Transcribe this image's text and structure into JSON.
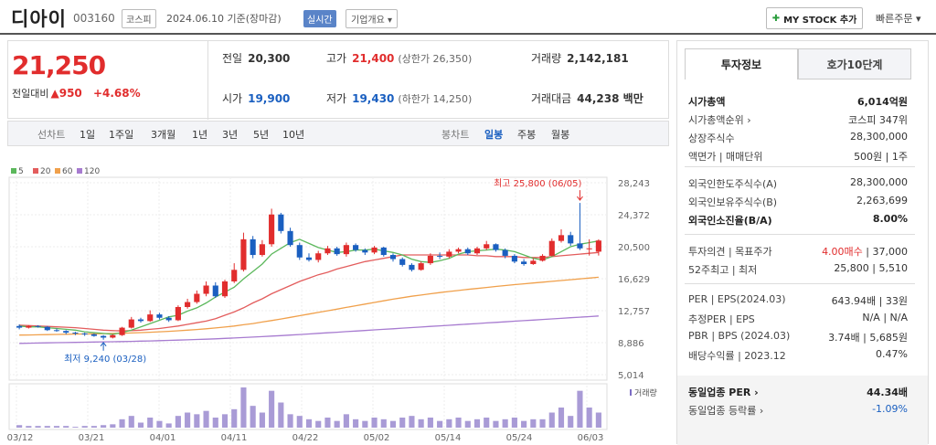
{
  "header": {
    "company": "디아이",
    "code": "003160",
    "market": "코스피",
    "date_info": "2024.06.10 기준(장마감)",
    "realtime": "실시간",
    "overview": "기업개요 ▾",
    "mystock_label": "MY STOCK 추가",
    "quick_order": "빠른주문 ▾"
  },
  "quote": {
    "price": "21,250",
    "change_label": "전일대비",
    "change_value": "▲950",
    "change_pct": "+4.68%",
    "prev_close_label": "전일",
    "prev_close": "20,300",
    "open_label": "시가",
    "open": "19,900",
    "high_label": "고가",
    "high": "21,400",
    "upper_limit": "(상한가 26,350)",
    "low_label": "저가",
    "low": "19,430",
    "lower_limit": "(하한가 14,250)",
    "volume_label": "거래량",
    "volume": "2,142,181",
    "amount_label": "거래대금",
    "amount": "44,238 백만"
  },
  "tabs": {
    "line_chart": "선차트",
    "periods": [
      "1일",
      "1주일",
      "3개월",
      "1년",
      "3년",
      "5년",
      "10년"
    ],
    "candle_chart": "봉차트",
    "candle_periods": [
      "일봉",
      "주봉",
      "월봉"
    ]
  },
  "side": {
    "tab_info": "투자정보",
    "tab_orderbook": "호가10단계",
    "rows1": [
      {
        "k": "시가총액",
        "v": "6,014억원",
        "bold": true
      },
      {
        "k": "시가총액순위 ›",
        "v": "코스피 347위"
      },
      {
        "k": "상장주식수",
        "v": "28,300,000"
      },
      {
        "k": "액면가 | 매매단위",
        "v": "500원 | 1주"
      }
    ],
    "rows2": [
      {
        "k": "외국인한도주식수(A)",
        "v": "28,300,000"
      },
      {
        "k": "외국인보유주식수(B)",
        "v": "2,263,699"
      },
      {
        "k": "외국인소진율(B/A)",
        "v": "8.00%",
        "bold": true
      }
    ],
    "rows3": [
      {
        "k": "투자의견 | 목표주가",
        "v": "4.00매수 | 37,000"
      },
      {
        "k": "52주최고 | 최저",
        "v": "25,800 | 5,510"
      }
    ],
    "rows4": [
      {
        "k": "PER | EPS(2024.03)",
        "v": "643.94배 | 33원"
      },
      {
        "k": "추정PER | EPS",
        "v": "N/A | N/A"
      },
      {
        "k": "PBR | BPS (2024.03)",
        "v": "3.74배 | 5,685원"
      },
      {
        "k": "배당수익률 | 2023.12",
        "v": "0.47%"
      }
    ],
    "rows5": [
      {
        "k": "동일업종 PER ›",
        "v": "44.34배",
        "bold": true
      },
      {
        "k": "동일업종 등락률 ›",
        "v": "-1.09%"
      }
    ]
  },
  "chart_data": {
    "type": "candlestick",
    "legend": [
      "5",
      "20",
      "60",
      "120"
    ],
    "legend_colors": [
      "#5cb85c",
      "#e35d5d",
      "#f0a04b",
      "#a77bd0"
    ],
    "y_ticks": [
      "28,243",
      "24,372",
      "20,500",
      "16,629",
      "12,757",
      "8,886",
      "5,014"
    ],
    "x_ticks": [
      "03/12",
      "03/21",
      "04/01",
      "04/11",
      "04/22",
      "05/02",
      "05/14",
      "05/24",
      "06/03"
    ],
    "high_annotation": "최고 25,800 (06/05)",
    "low_annotation": "최저 9,240 (03/28)",
    "volume_label": "거래량",
    "ylim": [
      5014,
      28243
    ],
    "candles": [
      [
        10900,
        10700,
        11100,
        10500
      ],
      [
        10700,
        10900,
        11000,
        10600
      ],
      [
        10900,
        10800,
        11000,
        10700
      ],
      [
        10800,
        10400,
        10900,
        10300
      ],
      [
        10400,
        10300,
        10600,
        10200
      ],
      [
        10300,
        10100,
        10400,
        9900
      ],
      [
        10100,
        10000,
        10200,
        9800
      ],
      [
        10000,
        9900,
        10100,
        9700
      ],
      [
        9900,
        9700,
        10000,
        9600
      ],
      [
        9700,
        9500,
        9800,
        9240
      ],
      [
        9500,
        9800,
        9900,
        9400
      ],
      [
        9800,
        10700,
        10800,
        9700
      ],
      [
        10700,
        11700,
        12000,
        10600
      ],
      [
        11700,
        11500,
        11900,
        11300
      ],
      [
        11500,
        12300,
        12800,
        11400
      ],
      [
        12300,
        11900,
        12500,
        11700
      ],
      [
        11900,
        11600,
        12100,
        11400
      ],
      [
        11600,
        13200,
        13400,
        11500
      ],
      [
        13200,
        13800,
        14200,
        13000
      ],
      [
        13800,
        14800,
        15200,
        13600
      ],
      [
        14800,
        15800,
        16300,
        14500
      ],
      [
        15800,
        14500,
        16200,
        14300
      ],
      [
        14500,
        16300,
        16500,
        14300
      ],
      [
        16300,
        17700,
        18500,
        16100
      ],
      [
        17700,
        21400,
        22200,
        17500
      ],
      [
        21400,
        19500,
        21800,
        19100
      ],
      [
        19500,
        20800,
        21300,
        19300
      ],
      [
        20800,
        24400,
        25100,
        20500
      ],
      [
        24400,
        22400,
        24600,
        22100
      ],
      [
        22400,
        20700,
        22800,
        20500
      ],
      [
        20700,
        19200,
        21000,
        18900
      ],
      [
        19200,
        18900,
        19700,
        18700
      ],
      [
        18900,
        19700,
        20000,
        18600
      ],
      [
        19700,
        20300,
        20600,
        19500
      ],
      [
        20300,
        19600,
        20500,
        19400
      ],
      [
        19600,
        20700,
        21000,
        19300
      ],
      [
        20700,
        20100,
        20900,
        19900
      ],
      [
        20100,
        19800,
        20300,
        19500
      ],
      [
        19800,
        20400,
        20600,
        19600
      ],
      [
        20400,
        19500,
        20500,
        19300
      ],
      [
        19500,
        19000,
        19700,
        18700
      ],
      [
        19000,
        18300,
        19200,
        18100
      ],
      [
        18300,
        17700,
        18500,
        17500
      ],
      [
        17700,
        18500,
        18700,
        17600
      ],
      [
        18500,
        19400,
        19700,
        18300
      ],
      [
        19400,
        19300,
        19800,
        19000
      ],
      [
        19300,
        19900,
        20200,
        19100
      ],
      [
        19900,
        20200,
        20400,
        19700
      ],
      [
        20200,
        19700,
        20400,
        19500
      ],
      [
        19700,
        20300,
        20500,
        19500
      ],
      [
        20300,
        20800,
        21200,
        20100
      ],
      [
        20800,
        20100,
        20900,
        19900
      ],
      [
        20100,
        19400,
        20300,
        19100
      ],
      [
        19400,
        18700,
        19600,
        18500
      ],
      [
        18700,
        18400,
        19000,
        18200
      ],
      [
        18400,
        18800,
        19100,
        18300
      ],
      [
        18800,
        19400,
        19600,
        18700
      ],
      [
        19400,
        21200,
        21500,
        19300
      ],
      [
        21200,
        21900,
        22600,
        21000
      ],
      [
        21900,
        20900,
        22300,
        20600
      ],
      [
        20900,
        20300,
        25800,
        20100
      ],
      [
        20300,
        20300,
        21400,
        19430
      ],
      [
        19900,
        21250,
        21400,
        19430
      ]
    ],
    "ma5": [
      10900,
      10800,
      10800,
      10700,
      10600,
      10500,
      10400,
      10200,
      10100,
      10000,
      9900,
      10100,
      10400,
      10800,
      11200,
      11600,
      12000,
      12200,
      12700,
      13100,
      13700,
      14400,
      15000,
      15600,
      16600,
      17500,
      18400,
      19600,
      20300,
      21000,
      21400,
      20900,
      20400,
      20100,
      19800,
      19900,
      20100,
      20100,
      20200,
      20000,
      19800,
      19500,
      19000,
      18700,
      18600,
      18800,
      19100,
      19600,
      19900,
      20000,
      20100,
      20200,
      20100,
      19900,
      19500,
      19100,
      18900,
      19300,
      19900,
      20500,
      20800,
      21000,
      21200
    ],
    "ma20": [
      11000,
      10950,
      10900,
      10850,
      10800,
      10750,
      10700,
      10600,
      10500,
      10400,
      10350,
      10300,
      10350,
      10400,
      10500,
      10600,
      10750,
      10900,
      11100,
      11300,
      11500,
      11800,
      12200,
      12600,
      13100,
      13700,
      14200,
      14800,
      15300,
      15800,
      16300,
      16700,
      17100,
      17400,
      17800,
      18100,
      18400,
      18700,
      18900,
      19100,
      19300,
      19500,
      19500,
      19500,
      19500,
      19500,
      19500,
      19500,
      19500,
      19400,
      19400,
      19300,
      19300,
      19300,
      19200,
      19200,
      19200,
      19300,
      19400,
      19500,
      19600,
      19700,
      19800
    ],
    "ma60": [
      9800,
      9820,
      9840,
      9860,
      9880,
      9900,
      9920,
      9940,
      9960,
      9980,
      10000,
      10030,
      10060,
      10100,
      10150,
      10200,
      10260,
      10320,
      10400,
      10480,
      10570,
      10670,
      10780,
      10900,
      11050,
      11200,
      11380,
      11560,
      11750,
      11950,
      12150,
      12350,
      12550,
      12750,
      12950,
      13150,
      13350,
      13550,
      13750,
      13950,
      14150,
      14330,
      14500,
      14650,
      14800,
      14950,
      15080,
      15200,
      15330,
      15450,
      15570,
      15690,
      15800,
      15910,
      16010,
      16110,
      16210,
      16310,
      16410,
      16510,
      16610,
      16710,
      16810
    ],
    "ma120": [
      8800,
      8820,
      8840,
      8860,
      8880,
      8900,
      8920,
      8940,
      8960,
      8980,
      9000,
      9020,
      9040,
      9070,
      9100,
      9130,
      9160,
      9190,
      9230,
      9270,
      9310,
      9350,
      9400,
      9450,
      9500,
      9560,
      9620,
      9680,
      9740,
      9800,
      9870,
      9940,
      10010,
      10080,
      10150,
      10220,
      10290,
      10360,
      10430,
      10500,
      10570,
      10640,
      10710,
      10780,
      10850,
      10920,
      10990,
      11060,
      11130,
      11200,
      11270,
      11340,
      11410,
      11480,
      11550,
      11620,
      11690,
      11760,
      11830,
      11900,
      11970,
      12040,
      12110
    ],
    "volume": [
      3,
      2,
      2,
      2,
      2,
      2,
      1,
      2,
      2,
      3,
      4,
      10,
      14,
      6,
      12,
      8,
      5,
      14,
      18,
      16,
      20,
      12,
      16,
      22,
      48,
      26,
      18,
      44,
      30,
      16,
      14,
      10,
      8,
      12,
      8,
      16,
      10,
      8,
      12,
      10,
      8,
      12,
      14,
      10,
      12,
      8,
      10,
      12,
      8,
      10,
      12,
      8,
      10,
      12,
      8,
      10,
      10,
      18,
      24,
      14,
      44,
      24,
      18
    ]
  }
}
